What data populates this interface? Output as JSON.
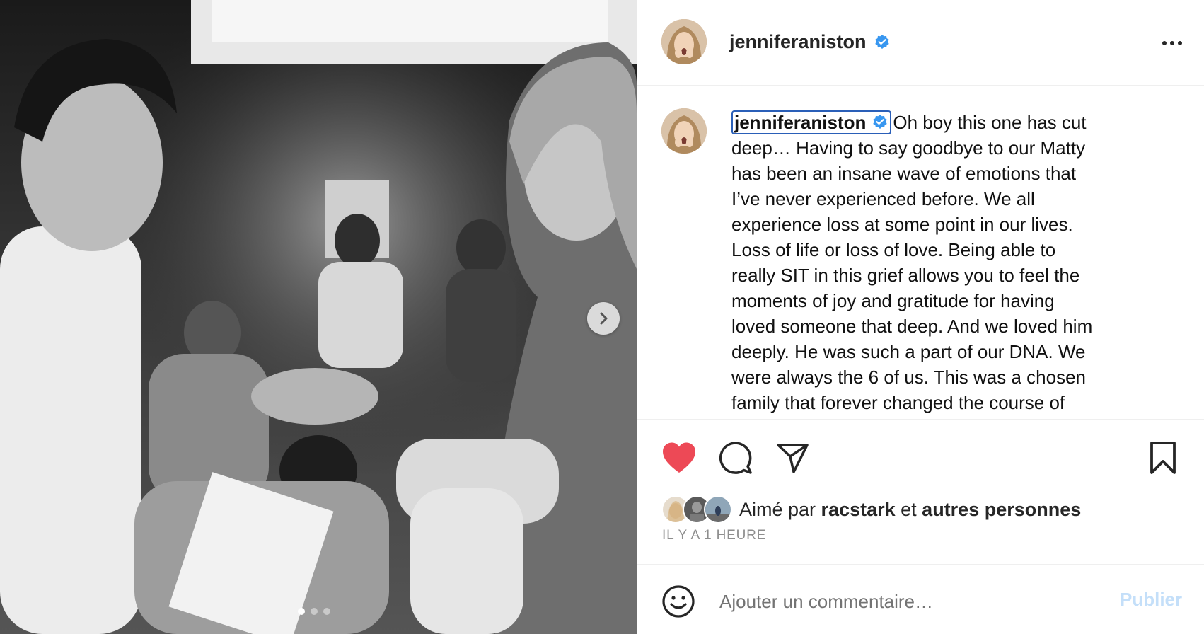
{
  "post": {
    "username": "jenniferaniston",
    "verified_icon": "verified-badge-icon",
    "more_icon": "more-options-icon",
    "caption_text": "Oh boy this one has cut deep… Having to say goodbye to our Matty has been an insane wave of emotions that I’ve never experienced before. We all experience loss at some point in our lives. Loss of life or loss of love. Being able to really SIT in this grief allows you to feel the moments of joy and gratitude for having loved someone that deep. And we loved him deeply. He was such a part of our DNA. We were always the 6 of us. This was a chosen family that forever changed the course of who we were and what our path was"
  },
  "media": {
    "current_slide": 1,
    "slide_count": 3,
    "next_icon": "chevron-right-icon"
  },
  "actions": {
    "like_icon": "heart-filled-icon",
    "comment_icon": "comment-icon",
    "share_icon": "paper-plane-icon",
    "save_icon": "bookmark-icon",
    "like_color": "#ed4956"
  },
  "likes": {
    "prefix": "Aimé par ",
    "user": "racstark",
    "middle": " et ",
    "others": "autres personnes"
  },
  "timestamp": "IL Y A 1 HEURE",
  "comment": {
    "placeholder": "Ajouter un commentaire…",
    "publish_label": "Publier",
    "emoji_icon": "smiley-icon"
  },
  "colors": {
    "verified": "#3897f0",
    "publish_disabled": "#c4dff9",
    "highlight_border": "#2a5fb8"
  }
}
